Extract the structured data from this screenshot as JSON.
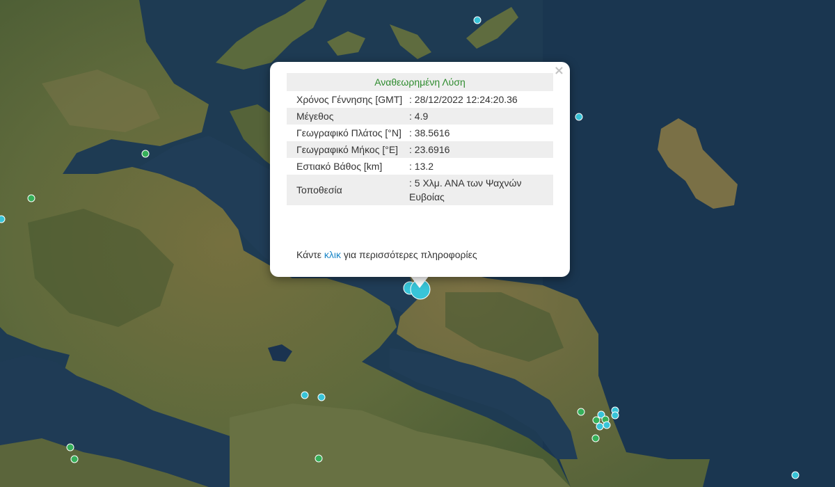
{
  "popup": {
    "header": "Αναθεωρημένη Λύση",
    "close": "×",
    "rows": [
      {
        "label": "Χρόνος Γέννησης [GMT]",
        "value": ": 28/12/2022 12:24:20.36"
      },
      {
        "label": "Μέγεθος",
        "value": ": 4.9"
      },
      {
        "label": "Γεωγραφικό Πλάτος [°N]",
        "value": ": 38.5616"
      },
      {
        "label": "Γεωγραφικό Μήκος [°E]",
        "value": ": 23.6916"
      },
      {
        "label": "Εστιακό Βάθος [km]",
        "value": ": 13.2"
      },
      {
        "label": "Τοποθεσία",
        "value": ": 5 Χλμ. ΑΝΑ των Ψαχνών Ευβοίας"
      }
    ],
    "more_prefix": "Κάντε ",
    "more_link": "κλικ",
    "more_suffix": " για περισσότερες πληροφορίες"
  },
  "colors": {
    "sea": "#1d3a52",
    "land": "#5e6b3e",
    "marker_cyan": "#38c4d8",
    "marker_green": "#36b05a"
  }
}
